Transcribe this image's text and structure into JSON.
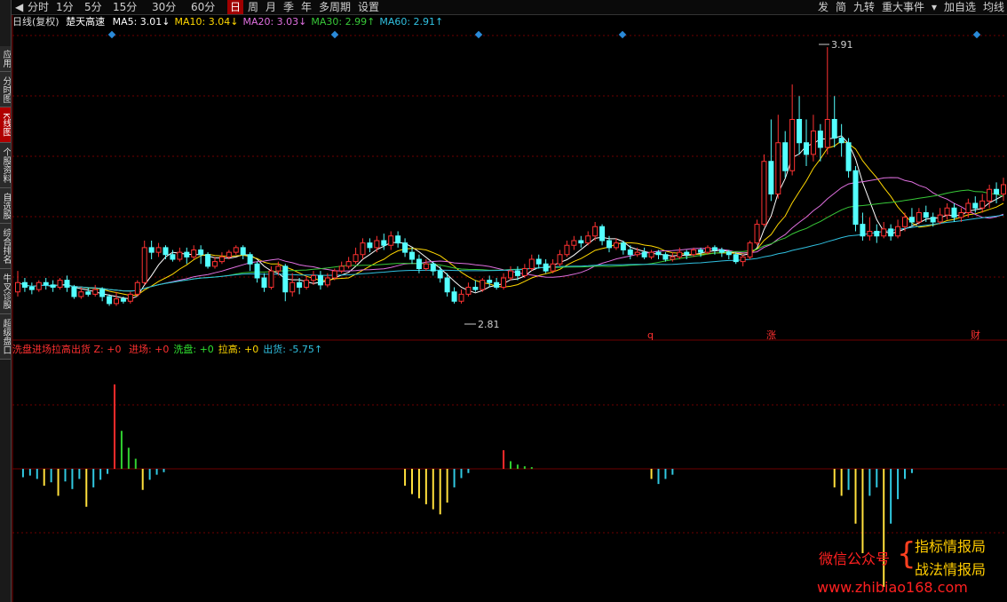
{
  "toolbar": {
    "left": [
      "分时",
      "1分",
      "5分",
      "15分",
      "30分",
      "60分",
      "日",
      "周",
      "月",
      "季",
      "年",
      "多周期",
      "设置"
    ],
    "active": "日",
    "right": [
      "发",
      "简",
      "九转",
      "重大事件",
      "加自选",
      "均线"
    ]
  },
  "sidebar": [
    "应用",
    "分时图",
    "K线图",
    "个股资料",
    "自选股",
    "综合排名",
    "牛叉诊股",
    "超级盘口"
  ],
  "sidebar_active": "K线图",
  "header": {
    "period": "日线(复权)",
    "stock": "楚天高速",
    "ma": [
      {
        "label": "MA5: 3.01↓",
        "color": "#ffffff"
      },
      {
        "label": "MA10: 3.04↓",
        "color": "#ffd700"
      },
      {
        "label": "MA20: 3.03↓",
        "color": "#e070e0"
      },
      {
        "label": "MA30: 2.99↑",
        "color": "#38c838"
      },
      {
        "label": "MA60: 2.91↑",
        "color": "#30c0e0"
      }
    ]
  },
  "annotations": {
    "high": "3.91",
    "low": "2.81",
    "mark_q": "q",
    "mark_zhang": "涨",
    "mark_cai": "财"
  },
  "indicator": {
    "name": "洗盘进场拉高出货 Z: +0",
    "items": [
      {
        "label": "进场: +0",
        "color": "#ff3030"
      },
      {
        "label": "洗盘: +0",
        "color": "#30e030"
      },
      {
        "label": "拉高: +0",
        "color": "#ffd700"
      },
      {
        "label": "出货: -5.75↑",
        "color": "#30c0e0"
      }
    ]
  },
  "watermark": {
    "left": "微信公众号",
    "line1": "指标情报局",
    "line2": "战法情报局",
    "url": "www.zhibiao168.com"
  },
  "colors": {
    "up": "#ff3232",
    "down": "#54ffff",
    "bg": "#000000",
    "grid": "#6e0000"
  },
  "chart_data": {
    "type": "candlestick",
    "price_range": [
      2.81,
      3.91
    ],
    "candles": [
      [
        2.86,
        2.9,
        2.95,
        2.84
      ],
      [
        2.9,
        2.88,
        2.92,
        2.86
      ],
      [
        2.88,
        2.87,
        2.9,
        2.85
      ],
      [
        2.87,
        2.9,
        2.91,
        2.86
      ],
      [
        2.9,
        2.89,
        2.92,
        2.87
      ],
      [
        2.89,
        2.88,
        2.91,
        2.86
      ],
      [
        2.88,
        2.91,
        2.92,
        2.87
      ],
      [
        2.91,
        2.88,
        2.93,
        2.86
      ],
      [
        2.88,
        2.84,
        2.89,
        2.83
      ],
      [
        2.84,
        2.86,
        2.88,
        2.83
      ],
      [
        2.86,
        2.85,
        2.88,
        2.84
      ],
      [
        2.85,
        2.87,
        2.89,
        2.84
      ],
      [
        2.87,
        2.84,
        2.88,
        2.82
      ],
      [
        2.84,
        2.81,
        2.85,
        2.8
      ],
      [
        2.81,
        2.83,
        2.86,
        2.8
      ],
      [
        2.83,
        2.82,
        2.84,
        2.81
      ],
      [
        2.82,
        2.85,
        2.86,
        2.81
      ],
      [
        2.85,
        2.9,
        2.91,
        2.84
      ],
      [
        2.9,
        3.05,
        3.08,
        2.89
      ],
      [
        3.05,
        3.03,
        3.08,
        3.0
      ],
      [
        3.03,
        3.05,
        3.07,
        3.01
      ],
      [
        3.05,
        3.02,
        3.06,
        3.0
      ],
      [
        3.02,
        3.0,
        3.04,
        2.99
      ],
      [
        3.0,
        3.03,
        3.05,
        2.99
      ],
      [
        3.03,
        3.01,
        3.05,
        2.98
      ],
      [
        3.01,
        3.04,
        3.06,
        3.0
      ],
      [
        3.04,
        3.02,
        3.06,
        2.98
      ],
      [
        3.02,
        2.97,
        3.03,
        2.96
      ],
      [
        2.97,
        2.99,
        3.01,
        2.96
      ],
      [
        2.99,
        3.01,
        3.03,
        2.98
      ],
      [
        3.01,
        3.03,
        3.04,
        3.0
      ],
      [
        3.03,
        3.05,
        3.06,
        3.02
      ],
      [
        3.05,
        3.02,
        3.06,
        3.0
      ],
      [
        3.02,
        2.98,
        3.03,
        2.95
      ],
      [
        2.98,
        2.92,
        2.99,
        2.9
      ],
      [
        2.92,
        2.88,
        2.94,
        2.86
      ],
      [
        2.88,
        2.95,
        2.97,
        2.87
      ],
      [
        2.95,
        2.97,
        2.99,
        2.93
      ],
      [
        2.97,
        2.86,
        2.98,
        2.82
      ],
      [
        2.86,
        2.9,
        2.94,
        2.84
      ],
      [
        2.9,
        2.88,
        2.92,
        2.85
      ],
      [
        2.88,
        2.91,
        2.93,
        2.87
      ],
      [
        2.91,
        2.93,
        2.95,
        2.89
      ],
      [
        2.93,
        2.89,
        2.95,
        2.87
      ],
      [
        2.89,
        2.92,
        2.94,
        2.88
      ],
      [
        2.92,
        2.95,
        2.96,
        2.91
      ],
      [
        2.95,
        2.97,
        2.99,
        2.94
      ],
      [
        2.97,
        2.99,
        3.01,
        2.96
      ],
      [
        2.99,
        3.02,
        3.05,
        2.98
      ],
      [
        3.02,
        3.07,
        3.09,
        3.0
      ],
      [
        3.07,
        3.05,
        3.09,
        3.03
      ],
      [
        3.05,
        3.08,
        3.1,
        3.03
      ],
      [
        3.08,
        3.06,
        3.11,
        3.04
      ],
      [
        3.06,
        3.1,
        3.12,
        3.04
      ],
      [
        3.1,
        3.07,
        3.12,
        3.05
      ],
      [
        3.07,
        3.03,
        3.09,
        3.01
      ],
      [
        3.03,
        3.0,
        3.05,
        2.98
      ],
      [
        3.0,
        2.96,
        3.02,
        2.94
      ],
      [
        2.96,
        2.98,
        3.0,
        2.95
      ],
      [
        2.98,
        2.95,
        2.99,
        2.93
      ],
      [
        2.95,
        2.92,
        2.97,
        2.9
      ],
      [
        2.92,
        2.86,
        2.94,
        2.84
      ],
      [
        2.86,
        2.82,
        2.88,
        2.81
      ],
      [
        2.82,
        2.85,
        2.87,
        2.81
      ],
      [
        2.85,
        2.88,
        2.9,
        2.84
      ],
      [
        2.88,
        2.87,
        2.91,
        2.86
      ],
      [
        2.87,
        2.91,
        2.92,
        2.86
      ],
      [
        2.91,
        2.9,
        2.93,
        2.88
      ],
      [
        2.9,
        2.88,
        2.92,
        2.87
      ],
      [
        2.88,
        2.92,
        2.94,
        2.87
      ],
      [
        2.92,
        2.95,
        2.97,
        2.91
      ],
      [
        2.95,
        2.93,
        2.97,
        2.91
      ],
      [
        2.93,
        2.96,
        2.98,
        2.92
      ],
      [
        2.96,
        3.0,
        3.02,
        2.95
      ],
      [
        3.0,
        2.98,
        3.02,
        2.96
      ],
      [
        2.98,
        2.95,
        3.0,
        2.94
      ],
      [
        2.95,
        2.98,
        3.0,
        2.94
      ],
      [
        2.98,
        3.02,
        3.04,
        2.97
      ],
      [
        3.02,
        3.06,
        3.08,
        3.01
      ],
      [
        3.06,
        3.08,
        3.1,
        3.04
      ],
      [
        3.08,
        3.07,
        3.1,
        3.05
      ],
      [
        3.07,
        3.1,
        3.12,
        3.06
      ],
      [
        3.1,
        3.14,
        3.16,
        3.08
      ],
      [
        3.14,
        3.08,
        3.15,
        3.06
      ],
      [
        3.08,
        3.05,
        3.1,
        3.03
      ],
      [
        3.05,
        3.07,
        3.09,
        3.04
      ],
      [
        3.07,
        3.04,
        3.08,
        3.02
      ],
      [
        3.04,
        3.02,
        3.06,
        3.0
      ],
      [
        3.02,
        3.03,
        3.05,
        3.01
      ],
      [
        3.03,
        3.01,
        3.05,
        3.0
      ],
      [
        3.01,
        3.03,
        3.04,
        3.0
      ],
      [
        3.03,
        3.02,
        3.04,
        3.0
      ],
      [
        3.02,
        3.0,
        3.03,
        2.99
      ],
      [
        3.0,
        3.01,
        3.03,
        2.99
      ],
      [
        3.01,
        3.03,
        3.05,
        3.0
      ],
      [
        3.03,
        3.02,
        3.04,
        3.0
      ],
      [
        3.02,
        3.04,
        3.05,
        3.01
      ],
      [
        3.04,
        3.03,
        3.05,
        3.01
      ],
      [
        3.03,
        3.05,
        3.06,
        3.02
      ],
      [
        3.05,
        3.04,
        3.06,
        3.02
      ],
      [
        3.04,
        3.03,
        3.05,
        3.01
      ],
      [
        3.03,
        3.02,
        3.04,
        3.0
      ],
      [
        3.02,
        2.99,
        3.03,
        2.98
      ],
      [
        2.99,
        3.01,
        3.02,
        2.97
      ],
      [
        3.01,
        3.07,
        3.08,
        3.0
      ],
      [
        3.07,
        3.15,
        3.17,
        3.06
      ],
      [
        3.15,
        3.42,
        3.45,
        3.14
      ],
      [
        3.42,
        3.28,
        3.6,
        3.25
      ],
      [
        3.28,
        3.5,
        3.62,
        3.26
      ],
      [
        3.5,
        3.38,
        3.55,
        3.35
      ],
      [
        3.38,
        3.6,
        3.75,
        3.36
      ],
      [
        3.6,
        3.5,
        3.7,
        3.45
      ],
      [
        3.5,
        3.45,
        3.6,
        3.4
      ],
      [
        3.45,
        3.55,
        3.62,
        3.42
      ],
      [
        3.55,
        3.48,
        3.58,
        3.42
      ],
      [
        3.48,
        3.6,
        3.91,
        3.45
      ],
      [
        3.6,
        3.52,
        3.7,
        3.48
      ],
      [
        3.52,
        3.5,
        3.58,
        3.44
      ],
      [
        3.5,
        3.38,
        3.52,
        3.35
      ],
      [
        3.38,
        3.15,
        3.4,
        3.12
      ],
      [
        3.15,
        3.1,
        3.2,
        3.08
      ],
      [
        3.1,
        3.12,
        3.18,
        3.08
      ],
      [
        3.12,
        3.1,
        3.15,
        3.07
      ],
      [
        3.1,
        3.13,
        3.16,
        3.09
      ],
      [
        3.13,
        3.1,
        3.15,
        3.08
      ],
      [
        3.1,
        3.14,
        3.17,
        3.09
      ],
      [
        3.14,
        3.18,
        3.2,
        3.12
      ],
      [
        3.18,
        3.16,
        3.22,
        3.14
      ],
      [
        3.16,
        3.2,
        3.22,
        3.15
      ],
      [
        3.2,
        3.18,
        3.23,
        3.16
      ],
      [
        3.18,
        3.16,
        3.2,
        3.14
      ],
      [
        3.16,
        3.19,
        3.22,
        3.15
      ],
      [
        3.19,
        3.22,
        3.24,
        3.17
      ],
      [
        3.22,
        3.18,
        3.24,
        3.16
      ],
      [
        3.18,
        3.2,
        3.22,
        3.16
      ],
      [
        3.2,
        3.24,
        3.26,
        3.18
      ],
      [
        3.24,
        3.22,
        3.27,
        3.2
      ],
      [
        3.22,
        3.25,
        3.28,
        3.2
      ],
      [
        3.25,
        3.3,
        3.32,
        3.22
      ],
      [
        3.3,
        3.28,
        3.33,
        3.24
      ],
      [
        3.28,
        3.32,
        3.35,
        3.25
      ]
    ],
    "ma_labels": [
      "MA5",
      "MA10",
      "MA20",
      "MA30",
      "MA60"
    ],
    "indicator_bars": [
      {
        "i": 1,
        "type": "down",
        "v": -1
      },
      {
        "i": 2,
        "type": "down",
        "v": -0.8
      },
      {
        "i": 3,
        "type": "down",
        "v": -1.2
      },
      {
        "i": 4,
        "type": "warn",
        "v": -2
      },
      {
        "i": 5,
        "type": "down",
        "v": -1.6
      },
      {
        "i": 6,
        "type": "warn",
        "v": -3.2
      },
      {
        "i": 7,
        "type": "down",
        "v": -1.5
      },
      {
        "i": 8,
        "type": "down",
        "v": -2.4
      },
      {
        "i": 9,
        "type": "down",
        "v": -1.2
      },
      {
        "i": 10,
        "type": "warn",
        "v": -4.5
      },
      {
        "i": 11,
        "type": "down",
        "v": -2.2
      },
      {
        "i": 12,
        "type": "down",
        "v": -1.3
      },
      {
        "i": 13,
        "type": "down",
        "v": -0.6
      },
      {
        "i": 14,
        "type": "up",
        "v": 10
      },
      {
        "i": 15,
        "type": "green",
        "v": 4.5
      },
      {
        "i": 16,
        "type": "green",
        "v": 2.5
      },
      {
        "i": 17,
        "type": "green",
        "v": 1.2
      },
      {
        "i": 18,
        "type": "warn",
        "v": -2.5
      },
      {
        "i": 19,
        "type": "down",
        "v": -1.3
      },
      {
        "i": 20,
        "type": "down",
        "v": -0.7
      },
      {
        "i": 21,
        "type": "down",
        "v": -0.4
      },
      {
        "i": 55,
        "type": "warn",
        "v": -2
      },
      {
        "i": 56,
        "type": "warn",
        "v": -3
      },
      {
        "i": 57,
        "type": "warn",
        "v": -3.5
      },
      {
        "i": 58,
        "type": "warn",
        "v": -4.2
      },
      {
        "i": 59,
        "type": "warn",
        "v": -4.8
      },
      {
        "i": 60,
        "type": "warn",
        "v": -5.4
      },
      {
        "i": 61,
        "type": "warn",
        "v": -4
      },
      {
        "i": 62,
        "type": "down",
        "v": -2.2
      },
      {
        "i": 63,
        "type": "down",
        "v": -1.1
      },
      {
        "i": 64,
        "type": "down",
        "v": -0.5
      },
      {
        "i": 69,
        "type": "up",
        "v": 2.2
      },
      {
        "i": 70,
        "type": "green",
        "v": 0.9
      },
      {
        "i": 71,
        "type": "green",
        "v": 0.5
      },
      {
        "i": 72,
        "type": "green",
        "v": 0.3
      },
      {
        "i": 73,
        "type": "green",
        "v": 0.2
      },
      {
        "i": 90,
        "type": "warn",
        "v": -1.2
      },
      {
        "i": 91,
        "type": "down",
        "v": -1.8
      },
      {
        "i": 92,
        "type": "down",
        "v": -1.2
      },
      {
        "i": 93,
        "type": "down",
        "v": -0.7
      },
      {
        "i": 116,
        "type": "warn",
        "v": -2.2
      },
      {
        "i": 117,
        "type": "warn",
        "v": -3.2
      },
      {
        "i": 118,
        "type": "down",
        "v": -2.5
      },
      {
        "i": 119,
        "type": "warn",
        "v": -6.5
      },
      {
        "i": 120,
        "type": "warn",
        "v": -10
      },
      {
        "i": 121,
        "type": "down",
        "v": -3.2
      },
      {
        "i": 122,
        "type": "down",
        "v": -2.2
      },
      {
        "i": 123,
        "type": "warn",
        "v": -14
      },
      {
        "i": 124,
        "type": "down",
        "v": -6.5
      },
      {
        "i": 125,
        "type": "down",
        "v": -3.6
      },
      {
        "i": 126,
        "type": "down",
        "v": -1.2
      },
      {
        "i": 127,
        "type": "down",
        "v": -0.5
      }
    ]
  }
}
